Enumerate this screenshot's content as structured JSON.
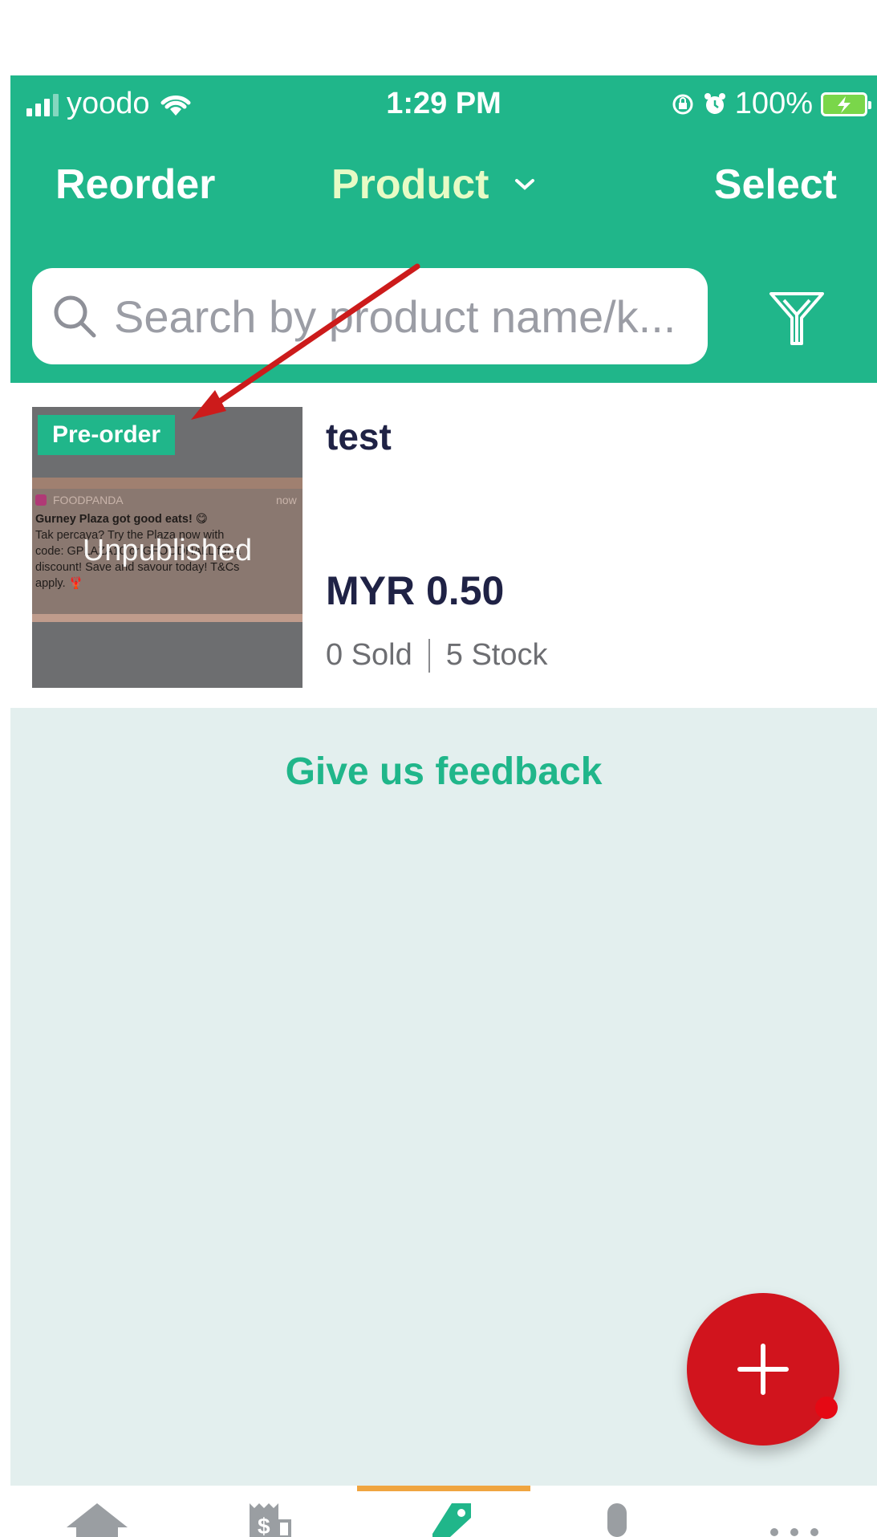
{
  "status_bar": {
    "carrier": "yoodo",
    "time": "1:29 PM",
    "battery": "100%"
  },
  "nav": {
    "reorder_label": "Reorder",
    "title": "Product",
    "select_label": "Select"
  },
  "search": {
    "placeholder": "Search by product name/k..."
  },
  "product": {
    "name": "test",
    "price": "MYR 0.50",
    "sold": "0 Sold",
    "stock": "5 Stock",
    "badge": "Pre-order",
    "status_overlay": "Unpublished",
    "thumbnail": {
      "app": "FOODPANDA",
      "time": "now",
      "headline": "Gurney Plaza got good eats! 😋",
      "line1": "Tak percaya? Try the Plaza now with",
      "line2": "code: GPLAZA10 or GFOODHALL for a",
      "line3": "discount! Save and savour today! T&Cs",
      "line4": "apply. 🦞"
    }
  },
  "feedback_label": "Give us feedback",
  "tabs": [
    {
      "icon": "home-icon"
    },
    {
      "icon": "receipt-icon"
    },
    {
      "icon": "tag-icon"
    },
    {
      "icon": "person-icon"
    },
    {
      "icon": "more-icon"
    }
  ],
  "colors": {
    "brand": "#20b68a",
    "title_active": "#e7fbc5",
    "fab": "#d1141d",
    "tab_indicator": "#f0a540",
    "annotation_arrow": "#cc1b1b",
    "background": "#e3efee"
  }
}
